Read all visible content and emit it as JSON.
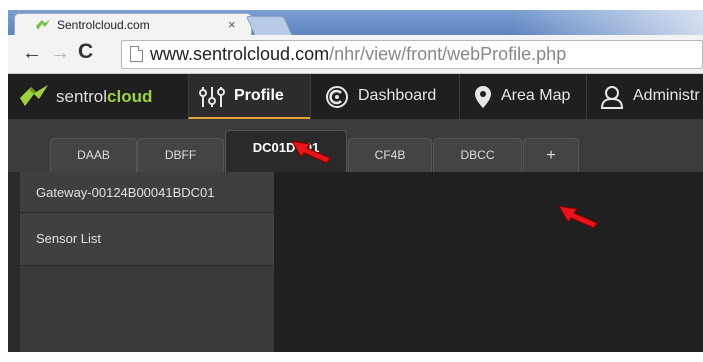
{
  "browser": {
    "tab_title": "Sentrolcloud.com",
    "tab_close": "×",
    "back": "←",
    "forward": "→",
    "reload": "C",
    "url_host": "www.sentrolcloud.com",
    "url_path": "/nhr/view/front/webProfile.php"
  },
  "app": {
    "logo_part1": "sentrol",
    "logo_part2": "cloud",
    "nav": [
      {
        "label": "Profile",
        "icon": "sliders-icon",
        "active": true
      },
      {
        "label": "Dashboard",
        "icon": "dashboard-icon",
        "active": false
      },
      {
        "label": "Area Map",
        "icon": "map-pin-icon",
        "active": false
      },
      {
        "label": "Administr",
        "icon": "user-icon",
        "active": false
      }
    ],
    "tabs": [
      {
        "label": "DAAB",
        "active": false
      },
      {
        "label": "DBFF",
        "active": false
      },
      {
        "label": "DC01DC01",
        "active": true
      },
      {
        "label": "CF4B",
        "active": false
      },
      {
        "label": "DBCC",
        "active": false
      },
      {
        "label": "+",
        "active": false
      }
    ],
    "sidebar": [
      {
        "label": "Gateway-00124B00041BDC01"
      },
      {
        "label": "Sensor List"
      }
    ]
  },
  "colors": {
    "brand_green": "#9fd33c",
    "active_underline": "#e8a23a",
    "arrow_red": "#e8131b"
  }
}
